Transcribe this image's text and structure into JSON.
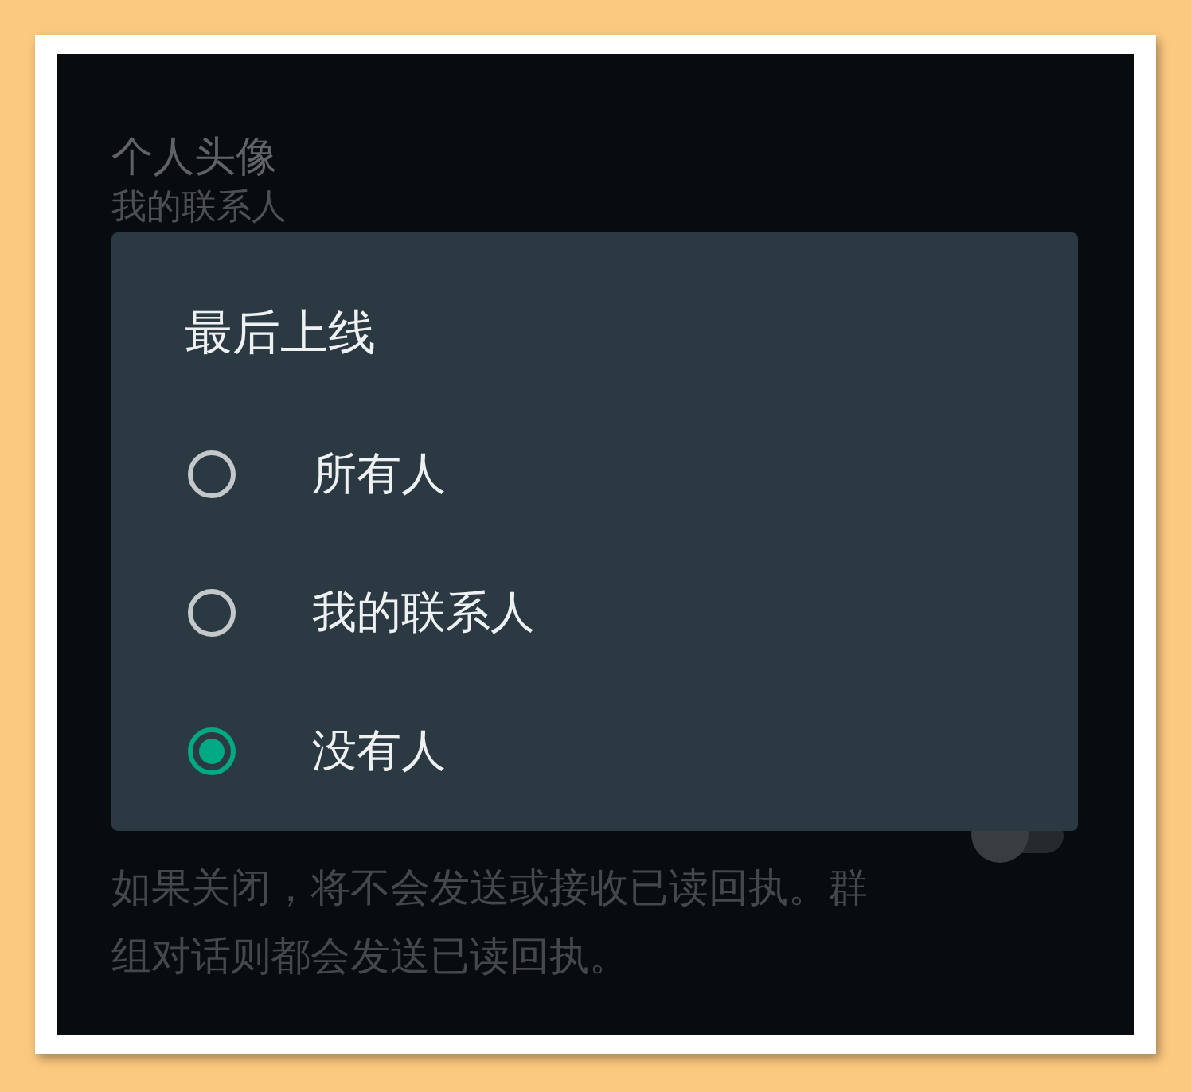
{
  "background_settings": {
    "profile_photo": {
      "title": "个人头像",
      "value": "我的联系人"
    },
    "read_receipts": {
      "on": false,
      "description": "如果关闭，将不会发送或接收已读回执。群组对话则都会发送已读回执。"
    }
  },
  "dialog": {
    "title": "最后上线",
    "options": [
      {
        "label": "所有人",
        "selected": false
      },
      {
        "label": "我的联系人",
        "selected": false
      },
      {
        "label": "没有人",
        "selected": true
      }
    ]
  }
}
